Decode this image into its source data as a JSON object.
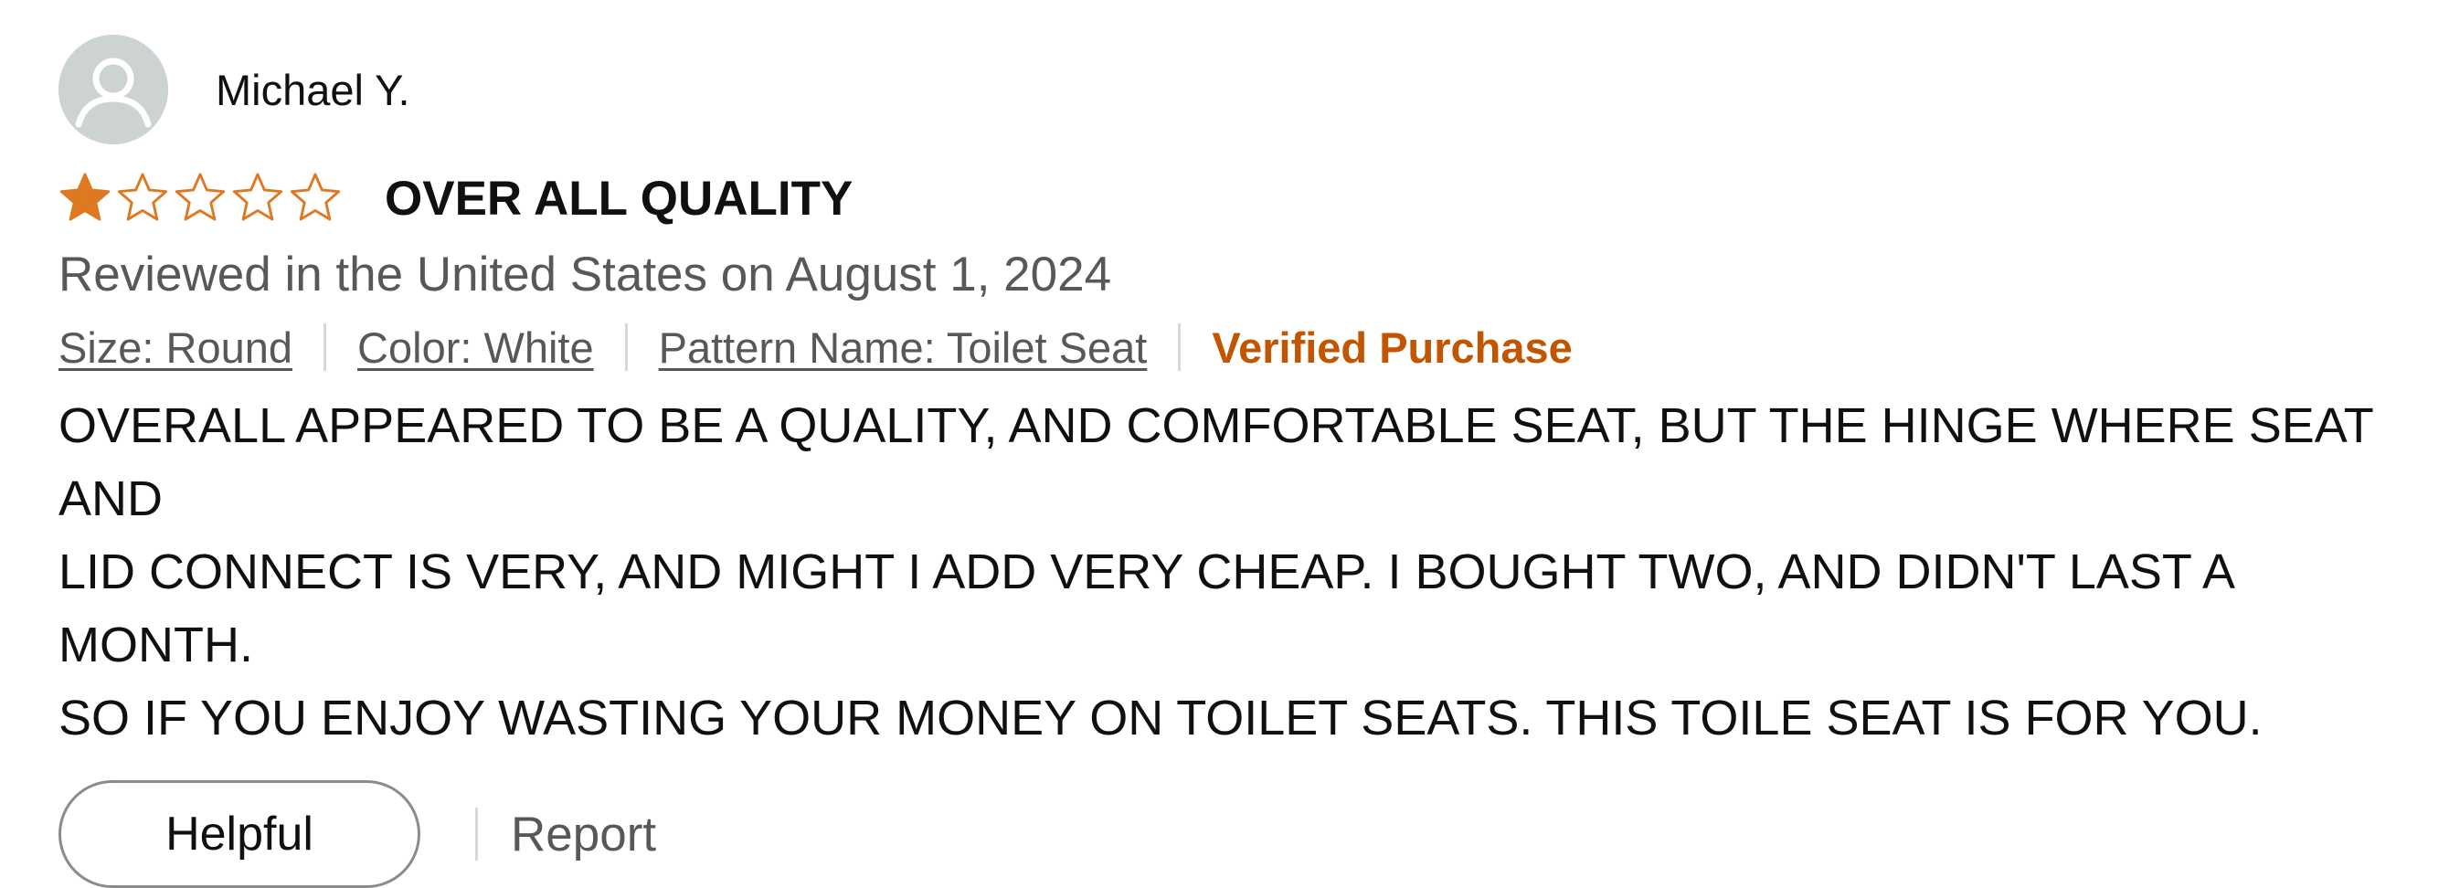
{
  "reviewer": {
    "name": "Michael Y.",
    "avatar_icon": "default-user-icon"
  },
  "rating": {
    "value": 1,
    "max": 5,
    "filled_color": "#de7921",
    "outline_color": "#de7921"
  },
  "review": {
    "title": "OVER ALL QUALITY",
    "date_text": "Reviewed in the United States on August 1, 2024",
    "variants": {
      "size": "Size: Round",
      "color": "Color: White",
      "pattern": "Pattern Name: Toilet Seat"
    },
    "verified_label": "Verified Purchase",
    "body": "OVERALL APPEARED TO BE A QUALITY, AND COMFORTABLE SEAT, BUT THE HINGE WHERE SEAT AND\nLID CONNECT IS VERY, AND MIGHT I ADD VERY CHEAP. I BOUGHT TWO, AND DIDN'T LAST A MONTH.\nSO IF YOU ENJOY WASTING YOUR MONEY ON TOILET SEATS. THIS TOILE SEAT IS FOR YOU."
  },
  "actions": {
    "helpful_label": "Helpful",
    "report_label": "Report"
  },
  "colors": {
    "verified": "#c45500",
    "secondary_text": "#565959"
  }
}
